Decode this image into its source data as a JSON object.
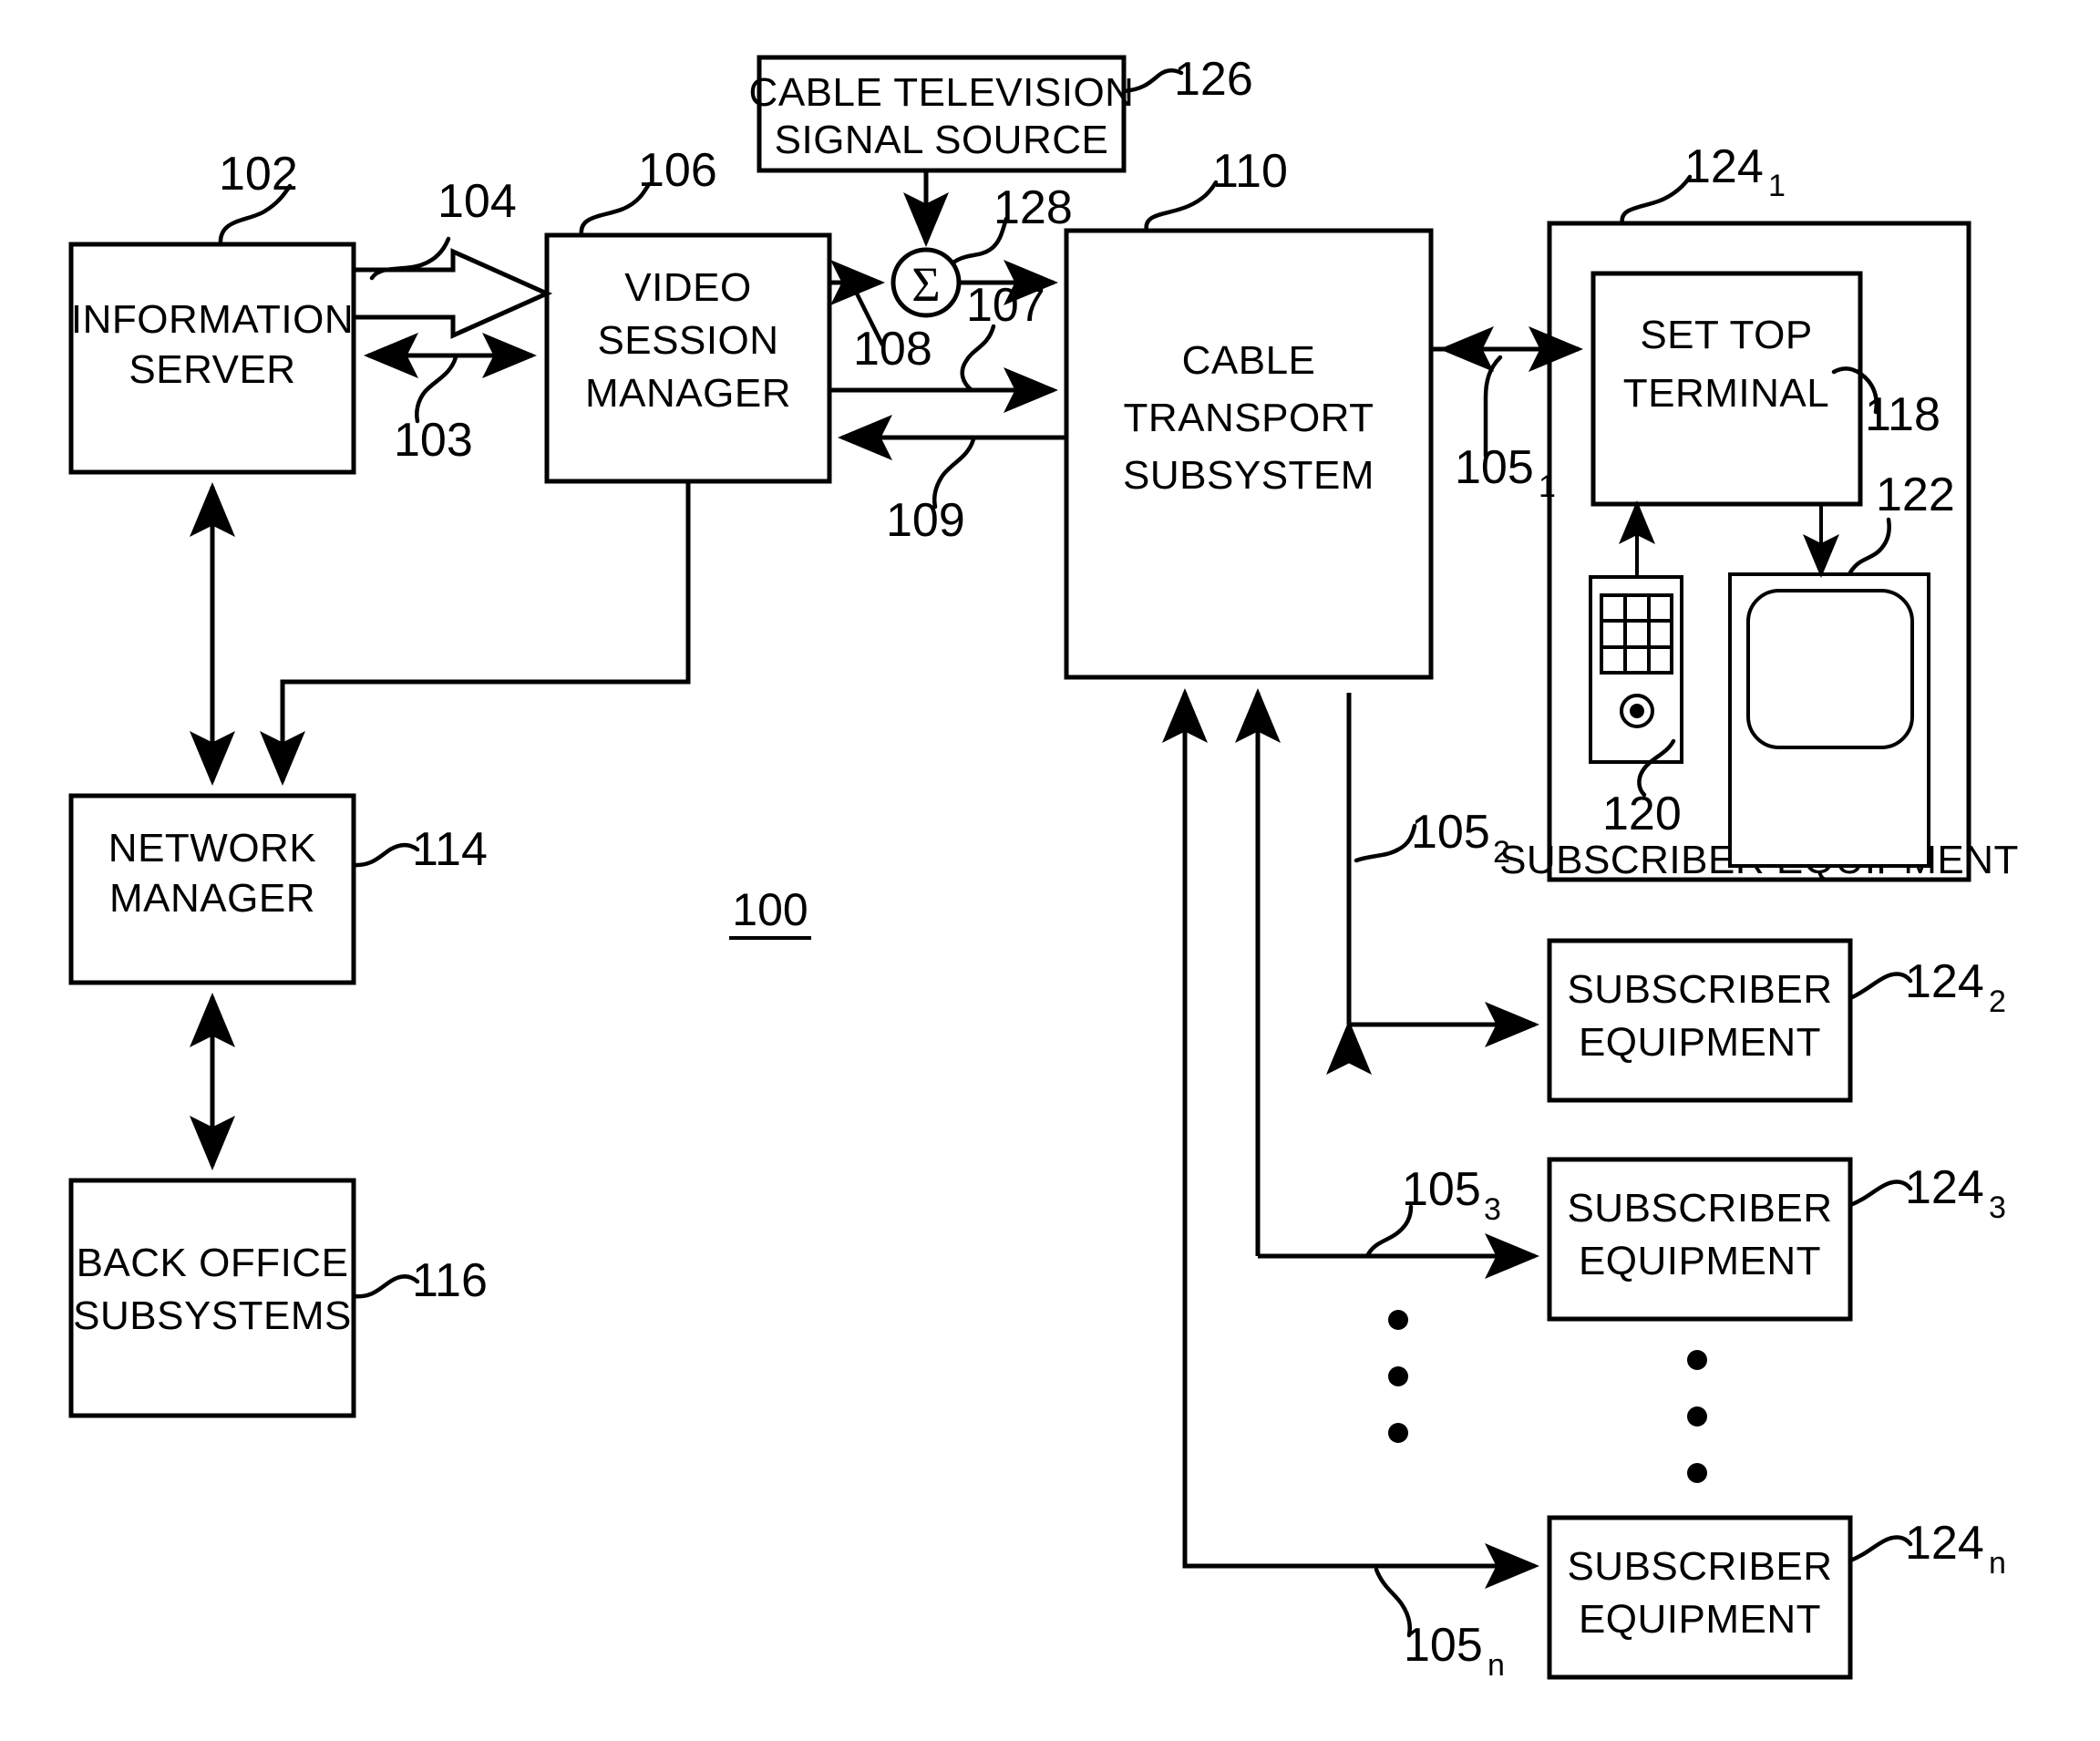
{
  "figure": {
    "number": "100",
    "type": "patent-block-diagram"
  },
  "blocks": {
    "information_server": {
      "line1": "INFORMATION",
      "line2": "SERVER",
      "ref": "102"
    },
    "video_session_manager": {
      "line1": "VIDEO",
      "line2": "SESSION",
      "line3": "MANAGER",
      "ref": "106"
    },
    "cable_tv_source": {
      "line1": "CABLE TELEVISION",
      "line2": "SIGNAL SOURCE",
      "ref": "126"
    },
    "cable_transport": {
      "line1": "CABLE",
      "line2": "TRANSPORT",
      "line3": "SUBSYSTEM",
      "ref": "110"
    },
    "network_manager": {
      "line1": "NETWORK",
      "line2": "MANAGER",
      "ref": "114"
    },
    "back_office": {
      "line1": "BACK OFFICE",
      "line2": "SUBSYSTEMS",
      "ref": "116"
    },
    "set_top_terminal": {
      "line1": "SET TOP",
      "line2": "TERMINAL",
      "ref": "118"
    },
    "subscriber_equipment_1": {
      "label": "SUBSCRIBER EQUIPMENT",
      "ref": "124",
      "sub": "1"
    },
    "subscriber_equipment_2": {
      "line1": "SUBSCRIBER",
      "line2": "EQUIPMENT",
      "ref": "124",
      "sub": "2"
    },
    "subscriber_equipment_3": {
      "line1": "SUBSCRIBER",
      "line2": "EQUIPMENT",
      "ref": "124",
      "sub": "3"
    },
    "subscriber_equipment_n": {
      "line1": "SUBSCRIBER",
      "line2": "EQUIPMENT",
      "ref": "124",
      "sub": "n"
    },
    "remote_control": {
      "ref": "120"
    },
    "television": {
      "ref": "122"
    },
    "summer": {
      "symbol": "Σ",
      "ref": "128"
    }
  },
  "connections": {
    "server_to_vsm_bulk": {
      "ref": "104"
    },
    "server_vsm_bidirectional": {
      "ref": "103"
    },
    "vsm_to_summer": {
      "ref": "108"
    },
    "vsm_to_transport": {
      "ref": "107"
    },
    "transport_to_vsm": {
      "ref": "109"
    },
    "link_1": {
      "ref": "105",
      "sub": "1"
    },
    "link_2": {
      "ref": "105",
      "sub": "2"
    },
    "link_3": {
      "ref": "105",
      "sub": "3"
    },
    "link_n": {
      "ref": "105",
      "sub": "n"
    }
  },
  "colors": {
    "stroke": "#000000",
    "background": "#ffffff"
  }
}
